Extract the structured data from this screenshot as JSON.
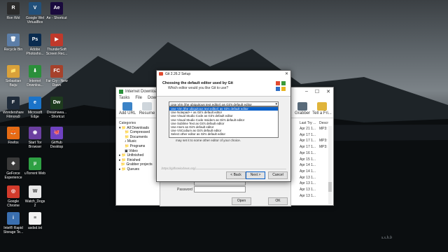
{
  "desktop_icons": [
    {
      "label": "Recycle Bin",
      "color": "#5c7ea8",
      "glyph": "🗑"
    },
    {
      "label": "Adobe\nPhotosho...",
      "color": "#0a2b4f",
      "glyph": "Ps"
    },
    {
      "label": "ThunderSoft\nScreen Rec...",
      "color": "#c0392b",
      "glyph": "▶"
    },
    {
      "label": "Sebastian\nBaiju",
      "color": "#d9a13a",
      "glyph": "📁"
    },
    {
      "label": "Internet\nDownloa...",
      "color": "#2a8f3a",
      "glyph": "⬇"
    },
    {
      "label": "Far Cry - New\nDawn",
      "color": "#a6412b",
      "glyph": "FC"
    },
    {
      "label": "Wondershare\nFilmora9",
      "color": "#1f2b3a",
      "glyph": "F"
    },
    {
      "label": "Microsoft\nEdge",
      "color": "#1a73c9",
      "glyph": "e"
    },
    {
      "label": "Dreamwea...\n- Shortcut",
      "color": "#1e3b1e",
      "glyph": "Dw"
    },
    {
      "label": "Firefox",
      "color": "#e66b14",
      "glyph": "🦊"
    },
    {
      "label": "Start Tor\nBrowser",
      "color": "#6b3fa0",
      "glyph": "◉"
    },
    {
      "label": "GitHub\nDesktop",
      "color": "#6f42c1",
      "glyph": "🐙"
    },
    {
      "label": "GeForce\nExperience",
      "color": "#3a3a3a",
      "glyph": "◈"
    },
    {
      "label": "uTorrent Web",
      "color": "#2ea043",
      "glyph": "µ"
    },
    {
      "label": "Google\nChrome",
      "color": "#d33b2c",
      "glyph": "◎"
    },
    {
      "label": "Watch_Dogs\n2",
      "color": "#e8e8e8",
      "glyph": "W"
    },
    {
      "label": "Intel® Rapid\nStorage Te...",
      "color": "#3a6fb0",
      "glyph": "i"
    },
    {
      "label": "asdsd.txt",
      "color": "#f2f2f2",
      "glyph": "≡"
    },
    {
      "label": "Ron Wol",
      "color": "#2b2b2b",
      "glyph": "R"
    },
    {
      "label": "Google Wel\nVirtualBox",
      "color": "#22507a",
      "glyph": "V"
    },
    {
      "label": "Ae - Shortcut",
      "color": "#1a0a3d",
      "glyph": "Ae"
    }
  ],
  "idm": {
    "title": "Internet Download M",
    "menu": [
      "Tasks",
      "File",
      "Downloads"
    ],
    "toolbar": {
      "add_url": "Add URL",
      "resume": "Resume",
      "grabber": "Grabber",
      "tell_friend": "Tell a Fri..."
    },
    "categories_header": "Categories",
    "categories": [
      "All Downloads",
      "Compressed",
      "Documents",
      "Music",
      "Programs",
      "Video",
      "Unfinished",
      "Finished",
      "Grabber projects",
      "Queues"
    ],
    "columns": {
      "last_try": "Last Try ...",
      "desc": "Descr"
    },
    "rows": [
      {
        "date": "Apr 21 1...",
        "desc": "MP3:"
      },
      {
        "date": "Apr 17 1...",
        "desc": ""
      },
      {
        "date": "Apr 17 1...",
        "desc": "MP3:"
      },
      {
        "date": "Apr 17 1...",
        "desc": "MP3:"
      },
      {
        "date": "Apr 16 1...",
        "desc": ""
      },
      {
        "date": "Apr 15 1...",
        "desc": ""
      },
      {
        "date": "Apr 14 1...",
        "desc": ""
      },
      {
        "date": "Apr 14 1...",
        "desc": ""
      },
      {
        "date": "Apr 13 1...",
        "desc": ""
      },
      {
        "date": "Apr 13 1...",
        "desc": ""
      },
      {
        "date": "Apr 13 1...",
        "desc": ""
      },
      {
        "date": "Apr 13 1...",
        "desc": ""
      }
    ]
  },
  "login": {
    "password_label": "Password",
    "ok": "OK",
    "open": "Open"
  },
  "git": {
    "title": "Git 2.26.2 Setup",
    "heading": "Choosing the default editor used by Git",
    "subheading": "Which editor would you like Git to use?",
    "selected": "Use Vim (the ubiquitous text editor) as Git's default editor",
    "options": [
      "Use Vim (the ubiquitous text editor) as Git's default editor",
      "Use Notepad++ as Git's default editor",
      "Use Visual Studio Code as Git's default editor",
      "Use Visual Studio Code Insiders as Git's default editor",
      "Use Sublime Text as Git's default editor",
      "Use Atom as Git's default editor",
      "Use VSCodium as Git's default editor",
      "Select other editor as Git's default editor"
    ],
    "description": "may set it to some other editor of your choice.",
    "url": "https://gitforwindows.org/",
    "back": "< Back",
    "next": "Next >",
    "cancel": "Cancel"
  },
  "watermark": "s.s.h.b"
}
